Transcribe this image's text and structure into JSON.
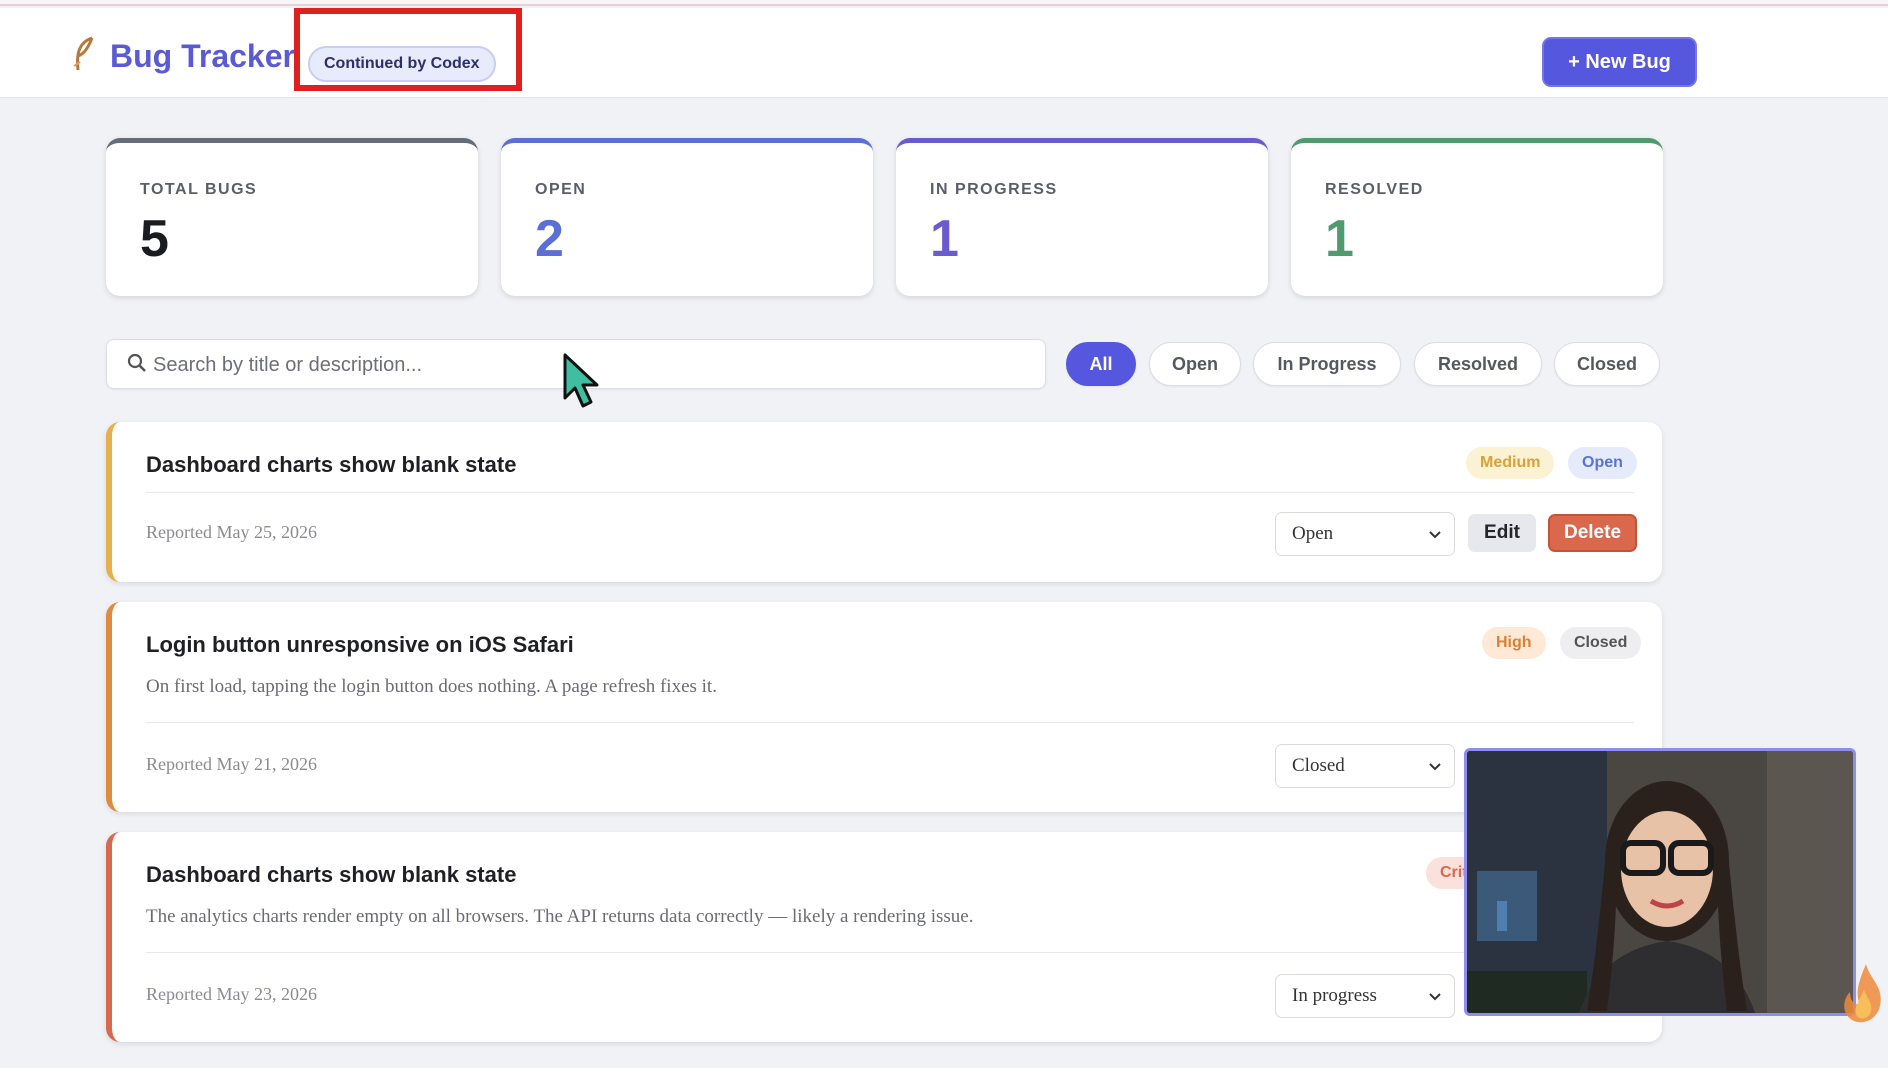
{
  "header": {
    "brand": "Bug Tracker",
    "badge": "Continued by Codex",
    "new_bug_label": "+ New Bug",
    "logo_icon": "feather-logo-icon"
  },
  "stats": [
    {
      "label": "TOTAL BUGS",
      "value": "5",
      "color": "#1b1c22",
      "accent": "#666c78"
    },
    {
      "label": "OPEN",
      "value": "2",
      "color": "#5b6fd6",
      "accent": "#5b6fd6"
    },
    {
      "label": "IN PROGRESS",
      "value": "1",
      "color": "#6a5bd0",
      "accent": "#6a5bd0"
    },
    {
      "label": "RESOLVED",
      "value": "1",
      "color": "#4f9a6e",
      "accent": "#4f9a6e"
    }
  ],
  "search": {
    "placeholder": "Search by title or description..."
  },
  "filters": [
    "All",
    "Open",
    "In Progress",
    "Resolved",
    "Closed"
  ],
  "active_filter": "All",
  "bugs": [
    {
      "title": "Dashboard charts show blank state",
      "description": "",
      "reported": "Reported May 25, 2026",
      "priority": "Medium",
      "status_badge": "Open",
      "status_select": "Open",
      "edit_label": "Edit",
      "delete_label": "Delete"
    },
    {
      "title": "Login button unresponsive on iOS Safari",
      "description": "On first load, tapping the login button does nothing. A page refresh fixes it.",
      "reported": "Reported May 21, 2026",
      "priority": "High",
      "status_badge": "Closed",
      "status_select": "Closed"
    },
    {
      "title": "Dashboard charts show blank state",
      "description": "The analytics charts render empty on all browsers. The API returns data correctly — likely a rendering issue.",
      "reported": "Reported May 23, 2026",
      "priority": "Crit",
      "status_select": "In progress"
    }
  ],
  "colors": {
    "accent": "#5557de",
    "highlight_box": "#e02020",
    "medium": "#e7b04a",
    "high": "#e08a3c",
    "critical": "#d9684d"
  }
}
